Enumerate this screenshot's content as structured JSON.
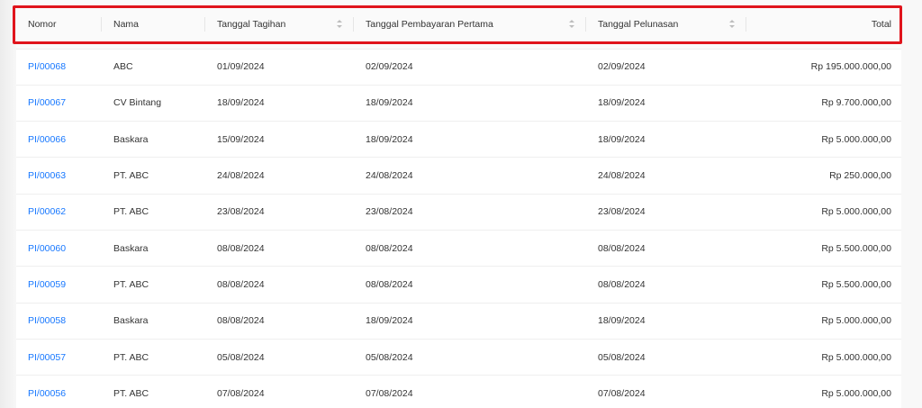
{
  "table": {
    "columns": [
      {
        "label": "Nomor",
        "sortable": false
      },
      {
        "label": "Nama",
        "sortable": false
      },
      {
        "label": "Tanggal Tagihan",
        "sortable": true
      },
      {
        "label": "Tanggal Pembayaran Pertama",
        "sortable": true
      },
      {
        "label": "Tanggal Pelunasan",
        "sortable": true
      },
      {
        "label": "Total",
        "sortable": false
      }
    ],
    "rows": [
      {
        "nomor": "PI/00068",
        "nama": "ABC",
        "tagihan": "01/09/2024",
        "bayar": "02/09/2024",
        "lunas": "02/09/2024",
        "total": "Rp 195.000.000,00"
      },
      {
        "nomor": "PI/00067",
        "nama": "CV Bintang",
        "tagihan": "18/09/2024",
        "bayar": "18/09/2024",
        "lunas": "18/09/2024",
        "total": "Rp 9.700.000,00"
      },
      {
        "nomor": "PI/00066",
        "nama": "Baskara",
        "tagihan": "15/09/2024",
        "bayar": "18/09/2024",
        "lunas": "18/09/2024",
        "total": "Rp 5.000.000,00"
      },
      {
        "nomor": "PI/00063",
        "nama": "PT. ABC",
        "tagihan": "24/08/2024",
        "bayar": "24/08/2024",
        "lunas": "24/08/2024",
        "total": "Rp 250.000,00"
      },
      {
        "nomor": "PI/00062",
        "nama": "PT. ABC",
        "tagihan": "23/08/2024",
        "bayar": "23/08/2024",
        "lunas": "23/08/2024",
        "total": "Rp 5.000.000,00"
      },
      {
        "nomor": "PI/00060",
        "nama": "Baskara",
        "tagihan": "08/08/2024",
        "bayar": "08/08/2024",
        "lunas": "08/08/2024",
        "total": "Rp 5.500.000,00"
      },
      {
        "nomor": "PI/00059",
        "nama": "PT. ABC",
        "tagihan": "08/08/2024",
        "bayar": "08/08/2024",
        "lunas": "08/08/2024",
        "total": "Rp 5.500.000,00"
      },
      {
        "nomor": "PI/00058",
        "nama": "Baskara",
        "tagihan": "08/08/2024",
        "bayar": "18/09/2024",
        "lunas": "18/09/2024",
        "total": "Rp 5.000.000,00"
      },
      {
        "nomor": "PI/00057",
        "nama": "PT. ABC",
        "tagihan": "05/08/2024",
        "bayar": "05/08/2024",
        "lunas": "05/08/2024",
        "total": "Rp 5.000.000,00"
      },
      {
        "nomor": "PI/00056",
        "nama": "PT. ABC",
        "tagihan": "07/08/2024",
        "bayar": "07/08/2024",
        "lunas": "07/08/2024",
        "total": "Rp 5.000.000,00"
      }
    ]
  },
  "colors": {
    "link": "#1677ff",
    "highlight_border": "#e0141c",
    "header_bg": "#fafafa"
  }
}
